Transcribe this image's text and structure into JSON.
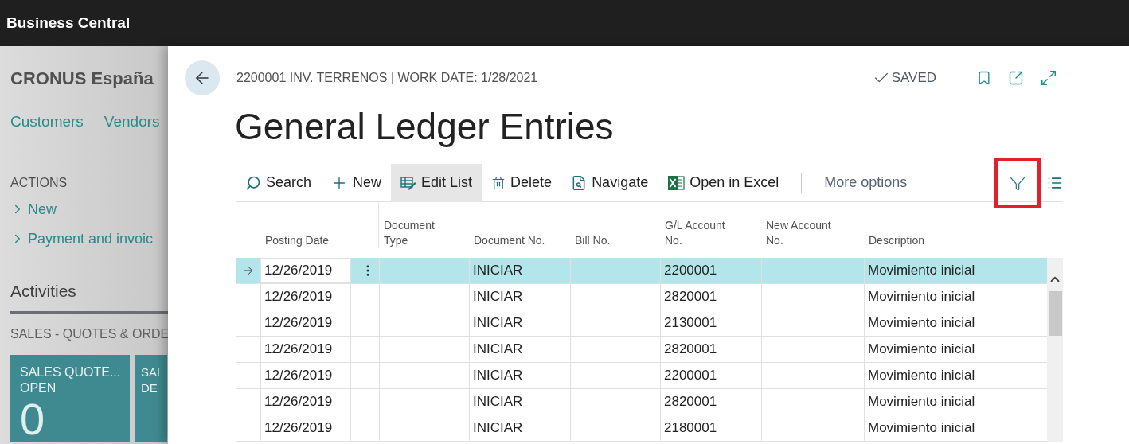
{
  "app_bar": {
    "title": "Business Central"
  },
  "background_page": {
    "company": "CRONUS España",
    "nav_links": [
      "Customers",
      "Vendors"
    ],
    "actions_heading": "ACTIONS",
    "actions": [
      "New",
      "Payment and invoic"
    ],
    "activities_heading": "Activities",
    "cue_group": "SALES - QUOTES & ORDE",
    "tiles": [
      {
        "label_lines": [
          "SALES QUOTE...",
          "OPEN"
        ],
        "value": "0"
      },
      {
        "label_lines": [
          "SAL",
          "DE"
        ]
      }
    ]
  },
  "panel": {
    "breadcrumb": "2200001 INV. TERRENOS | WORK DATE: 1/28/2021",
    "status": "SAVED",
    "title": "General Ledger Entries",
    "toolbar": [
      {
        "kind": "search",
        "label": "Search",
        "selected": false
      },
      {
        "kind": "new",
        "label": "New",
        "selected": false
      },
      {
        "kind": "edit_list",
        "label": "Edit List",
        "selected": true
      },
      {
        "kind": "delete",
        "label": "Delete",
        "selected": false
      },
      {
        "kind": "navigate",
        "label": "Navigate",
        "selected": false
      },
      {
        "kind": "excel",
        "label": "Open in Excel",
        "selected": false
      },
      {
        "kind": "more",
        "label": "More options",
        "selected": false
      }
    ],
    "filter_button": {
      "highlighted": true
    },
    "columns": [
      "Posting Date",
      "Document Type",
      "Document No.",
      "Bill No.",
      "G/L Account No.",
      "New Account No.",
      "Description"
    ],
    "rows": [
      {
        "selected": true,
        "cells": [
          "12/26/2019",
          "",
          "INICIAR",
          "",
          "2200001",
          "",
          "Movimiento inicial"
        ]
      },
      {
        "selected": false,
        "cells": [
          "12/26/2019",
          "",
          "INICIAR",
          "",
          "2820001",
          "",
          "Movimiento inicial"
        ]
      },
      {
        "selected": false,
        "cells": [
          "12/26/2019",
          "",
          "INICIAR",
          "",
          "2130001",
          "",
          "Movimiento inicial"
        ]
      },
      {
        "selected": false,
        "cells": [
          "12/26/2019",
          "",
          "INICIAR",
          "",
          "2820001",
          "",
          "Movimiento inicial"
        ]
      },
      {
        "selected": false,
        "cells": [
          "12/26/2019",
          "",
          "INICIAR",
          "",
          "2200001",
          "",
          "Movimiento inicial"
        ]
      },
      {
        "selected": false,
        "cells": [
          "12/26/2019",
          "",
          "INICIAR",
          "",
          "2820001",
          "",
          "Movimiento inicial"
        ]
      },
      {
        "selected": false,
        "cells": [
          "12/26/2019",
          "",
          "INICIAR",
          "",
          "2180001",
          "",
          "Movimiento inicial"
        ]
      }
    ]
  }
}
